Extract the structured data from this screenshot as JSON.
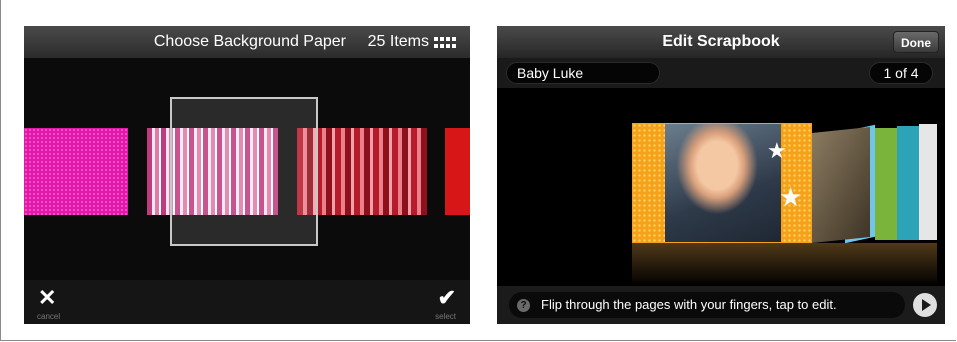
{
  "left_screen": {
    "header": {
      "title": "Choose Background Paper",
      "count": "25 Items",
      "grid_icon": "grid-icon"
    },
    "footer": {
      "cancel_label": "cancel",
      "select_label": "select",
      "cancel_icon": "close-icon",
      "select_icon": "checkmark-icon"
    }
  },
  "right_screen": {
    "header": {
      "title": "Edit Scrapbook",
      "done_label": "Done"
    },
    "subheader": {
      "book_name": "Baby Luke",
      "page_indicator": "1 of 4"
    },
    "hint": {
      "text": "Flip through the pages with your fingers, tap to edit.",
      "help_icon": "help-icon",
      "next_icon": "play-icon"
    }
  },
  "colors": {
    "accent_pink": "#e21aa8",
    "accent_red": "#d61617",
    "orange_page": "#f5a21a"
  }
}
